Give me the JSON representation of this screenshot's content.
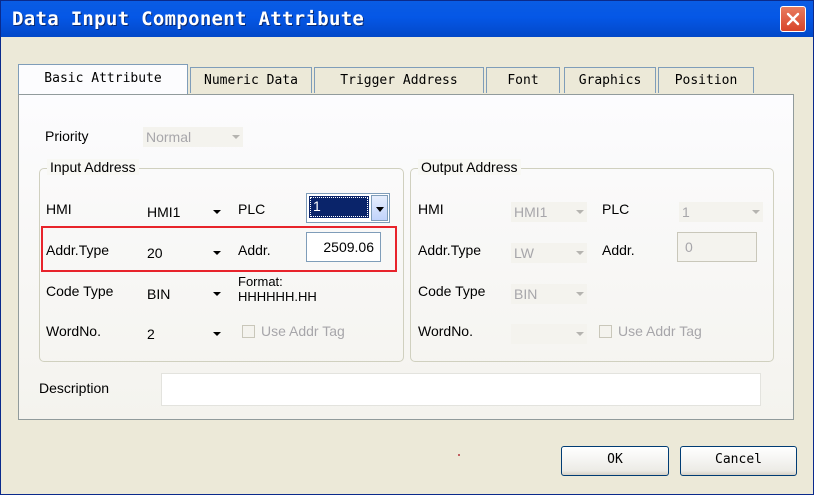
{
  "window": {
    "title": "Data Input Component Attribute"
  },
  "tabs": [
    {
      "label": "Basic Attribute",
      "active": true
    },
    {
      "label": "Numeric Data",
      "active": false
    },
    {
      "label": "Trigger Address",
      "active": false
    },
    {
      "label": "Font",
      "active": false
    },
    {
      "label": "Graphics",
      "active": false
    },
    {
      "label": "Position",
      "active": false
    }
  ],
  "priority": {
    "label": "Priority",
    "value": "Normal"
  },
  "input_address": {
    "legend": "Input Address",
    "hmi_label": "HMI",
    "hmi_value": "HMI1",
    "plc_label": "PLC",
    "plc_value": "1",
    "addr_type_label": "Addr.Type",
    "addr_type_value": "20",
    "addr_label": "Addr.",
    "addr_value": "2509.06",
    "code_type_label": "Code Type",
    "code_type_value": "BIN",
    "format_label": "Format:",
    "format_value": "HHHHHH.HH",
    "word_no_label": "WordNo.",
    "word_no_value": "2",
    "use_addr_tag_label": "Use Addr Tag"
  },
  "output_address": {
    "legend": "Output Address",
    "hmi_label": "HMI",
    "hmi_value": "HMI1",
    "plc_label": "PLC",
    "plc_value": "1",
    "addr_type_label": "Addr.Type",
    "addr_type_value": "LW",
    "addr_label": "Addr.",
    "addr_value": "0",
    "code_type_label": "Code Type",
    "code_type_value": "BIN",
    "word_no_label": "WordNo.",
    "word_no_value": "",
    "use_addr_tag_label": "Use Addr Tag"
  },
  "description": {
    "label": "Description",
    "value": ""
  },
  "buttons": {
    "ok": "OK",
    "cancel": "Cancel"
  },
  "colors": {
    "titlebar": "#0557e6",
    "highlight": "#e8232b",
    "dialog_bg": "#ece9d8"
  },
  "icons": {
    "close": "close-icon"
  }
}
